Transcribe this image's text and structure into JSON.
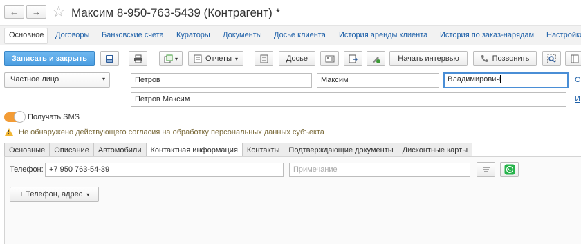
{
  "window": {
    "title": "Максим 8-950-763-5439 (Контрагент) *",
    "back_glyph": "←",
    "forward_glyph": "→",
    "star_glyph": "☆"
  },
  "nav": {
    "items": [
      {
        "label": "Основное"
      },
      {
        "label": "Договоры"
      },
      {
        "label": "Банковские счета"
      },
      {
        "label": "Кураторы"
      },
      {
        "label": "Документы"
      },
      {
        "label": "Досье клиента"
      },
      {
        "label": "История аренды клиента"
      },
      {
        "label": "История по заказ-нарядам"
      },
      {
        "label": "Настройки"
      }
    ]
  },
  "toolbar": {
    "save_close": "Записать и закрыть",
    "reports": "Отчеты",
    "dossier": "Досье",
    "start_interview": "Начать интервью",
    "call": "Позвонить"
  },
  "form": {
    "person_type": "Частное лицо",
    "last_name": "Петров",
    "first_name": "Максим",
    "middle_name": "Владимирович",
    "full_name": "Петров Максим",
    "link_right_1": "С",
    "link_right_2": "И"
  },
  "sms": {
    "label": "Получать SMS",
    "enabled": true
  },
  "warning": {
    "text": "Не обнаружено действующего согласия на обработку персональных данных субъекта"
  },
  "tabs": {
    "items": [
      {
        "label": "Основные"
      },
      {
        "label": "Описание"
      },
      {
        "label": "Автомобили"
      },
      {
        "label": "Контактная информация",
        "active": true
      },
      {
        "label": "Контакты"
      },
      {
        "label": "Подтверждающие документы"
      },
      {
        "label": "Дисконтные карты"
      }
    ]
  },
  "contact": {
    "phone_label": "Телефон:",
    "phone_value": "+7 950 763-54-39",
    "note_placeholder": "Примечание",
    "add_button": "+ Телефон, адрес"
  },
  "colors": {
    "primary": "#4a9de0",
    "link": "#1c5fa8",
    "toggle": "#f39c36",
    "warning_text": "#7a6a3a",
    "whatsapp": "#25b34a"
  }
}
